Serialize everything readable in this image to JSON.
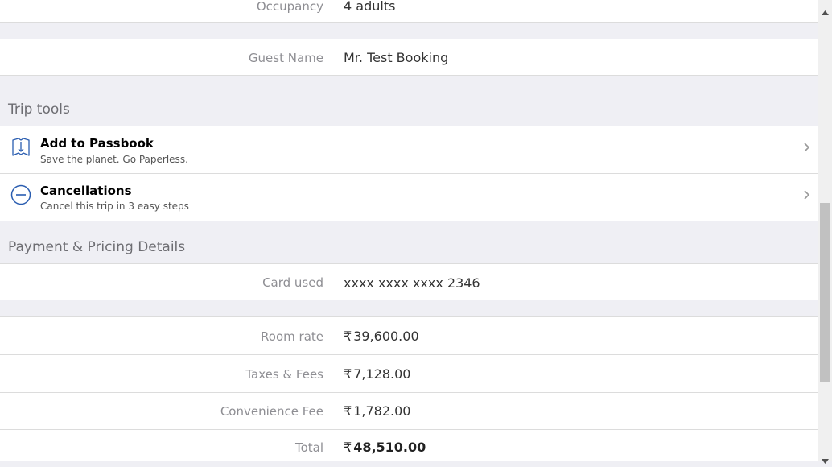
{
  "booking": {
    "occupancy_label": "Occupancy",
    "occupancy_value": "4 adults",
    "guest_label": "Guest Name",
    "guest_value": "Mr. Test Booking"
  },
  "trip_tools": {
    "title": "Trip tools",
    "items": [
      {
        "title": "Add to Passbook",
        "subtitle": "Save the planet. Go Paperless.",
        "icon": "passbook-icon"
      },
      {
        "title": "Cancellations",
        "subtitle": "Cancel this trip in 3 easy steps",
        "icon": "minus-circle-icon"
      }
    ]
  },
  "payment": {
    "title": "Payment & Pricing Details",
    "card_label": "Card used",
    "card_value": "xxxx xxxx xxxx 2346",
    "currency_symbol": "₹",
    "rows": [
      {
        "label": "Room rate",
        "value": "39,600.00"
      },
      {
        "label": "Taxes & Fees",
        "value": "7,128.00"
      },
      {
        "label": "Convenience Fee",
        "value": "1,782.00"
      },
      {
        "label": "Total",
        "value": "48,510.00"
      }
    ]
  },
  "colors": {
    "background": "#efeff4",
    "icon_blue": "#2a5db0"
  }
}
